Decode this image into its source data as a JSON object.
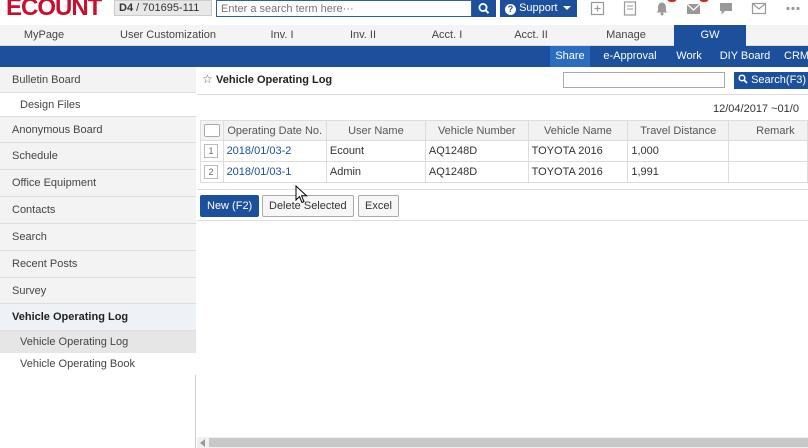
{
  "topbar": {
    "logo": "ECOUNT",
    "company_prefix": "D4",
    "company_id": "/ 701695-111",
    "search_placeholder": "Enter a search term here···",
    "support_label": "Support",
    "icons": [
      "add-window-icon",
      "document-icon",
      "bell-icon",
      "mail-check-icon",
      "chat-icon",
      "envelope-icon",
      "more-icon"
    ]
  },
  "mainnav": {
    "tabs": [
      "MyPage",
      "User Customization",
      "Inv. I",
      "Inv. II",
      "Acct. I",
      "Acct. II",
      "Manage",
      "GW"
    ],
    "active": "GW"
  },
  "subnav": {
    "items": [
      "Share",
      "e-Approval",
      "Work",
      "DIY Board",
      "CRM"
    ],
    "active": "Share"
  },
  "sidebar": {
    "items": [
      {
        "label": "Bulletin Board"
      },
      {
        "label": "Design Files"
      },
      {
        "label": "Anonymous Board"
      },
      {
        "label": "Schedule"
      },
      {
        "label": "Office Equipment"
      },
      {
        "label": "Contacts"
      },
      {
        "label": "Search"
      },
      {
        "label": "Recent Posts"
      },
      {
        "label": "Survey"
      },
      {
        "label": "Vehicle Operating Log"
      },
      {
        "label": "Vehicle Operating Log"
      },
      {
        "label": "Vehicle Operating Book"
      }
    ]
  },
  "content": {
    "title": "Vehicle Operating Log",
    "search_button": "Search(F3)",
    "date_range": "12/04/2017 ~01/0",
    "table": {
      "columns": [
        "Operating Date No.",
        "User Name",
        "Vehicle Number",
        "Vehicle Name",
        "Travel Distance",
        "Remark"
      ],
      "rows": [
        {
          "num": "1",
          "date_no": "2018/01/03-2",
          "user": "Ecount",
          "vehicle_number": "AQ1248D",
          "vehicle_name": "TOYOTA 2016",
          "distance": "1,000",
          "remark": ""
        },
        {
          "num": "2",
          "date_no": "2018/01/03-1",
          "user": "Admin",
          "vehicle_number": "AQ1248D",
          "vehicle_name": "TOYOTA 2016",
          "distance": "1,991",
          "remark": ""
        }
      ]
    },
    "buttons": {
      "new": "New (F2)",
      "delete": "Delete Selected",
      "excel": "Excel"
    }
  },
  "colors": {
    "brand_red": "#c8102e",
    "accent_blue": "#1c4f9c",
    "notification_red": "#d9261c"
  }
}
